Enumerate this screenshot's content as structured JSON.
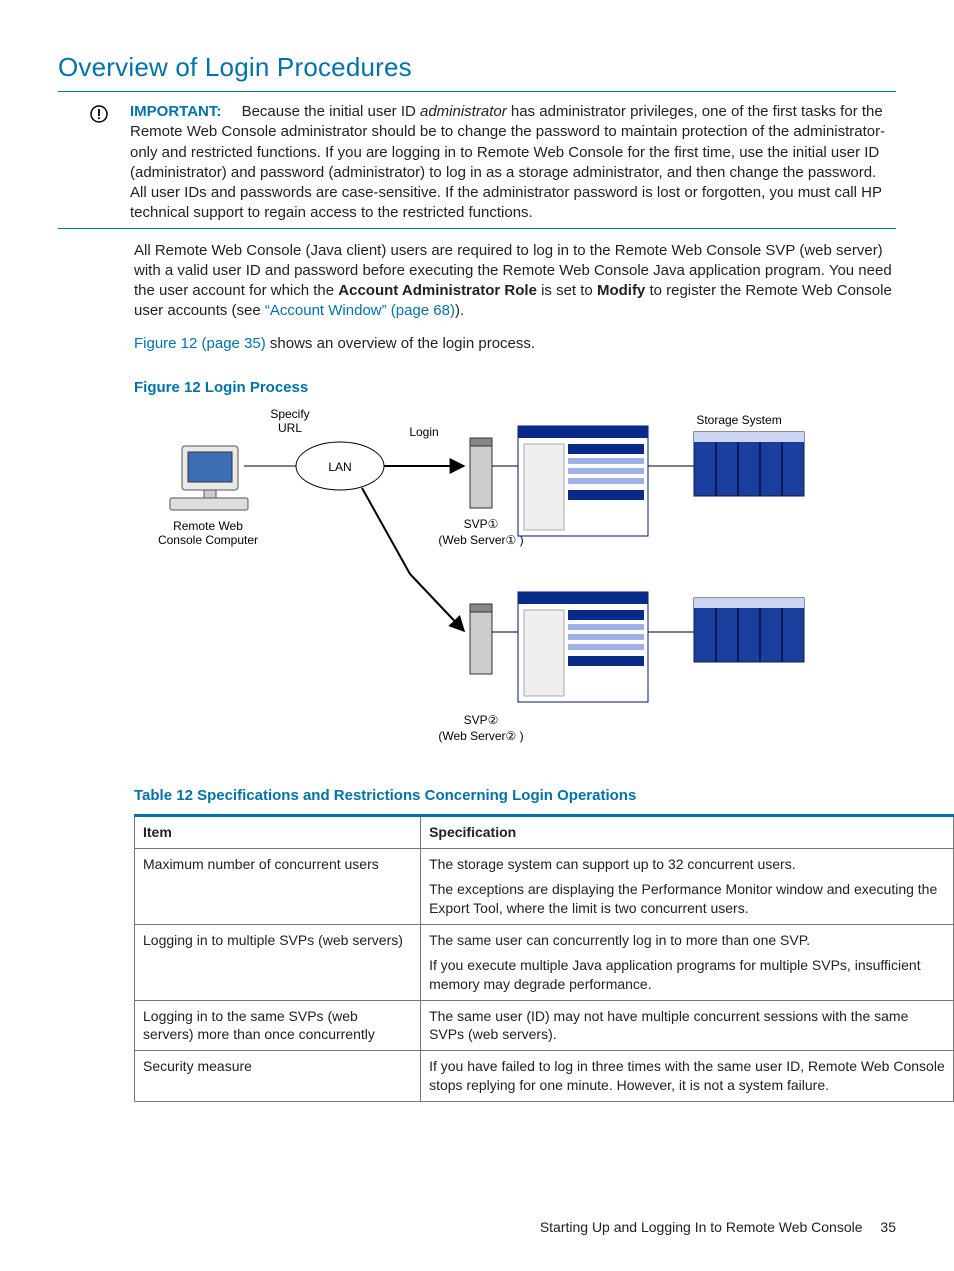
{
  "heading": "Overview of Login Procedures",
  "important": {
    "icon_name": "important-icon",
    "label": "IMPORTANT:",
    "leading": "Because the initial user ID ",
    "emph": "administrator",
    "rest": " has administrator privileges, one of the first tasks for the Remote Web Console administrator should be to change the password to maintain protection of the administrator-only and restricted functions. If you are logging in to Remote Web Console for the first time, use the initial user ID (administrator) and password (administrator) to log in as a storage administrator, and then change the password. All user IDs and passwords are case-sensitive. If the administrator password is lost or forgotten, you must call HP technical support to regain access to the restricted functions."
  },
  "p1": {
    "a": "All Remote Web Console (Java client) users are required to log in to the Remote Web Console SVP (web server) with a valid user ID and password before executing the Remote Web Console Java application program. You need the user account for which the ",
    "b_bold": "Account Administrator Role",
    "c": " is set to ",
    "d_bold": "Modify",
    "e": " to register the Remote Web Console user accounts (see ",
    "link": "“Account Window” (page 68)",
    "f": ")."
  },
  "p2": {
    "link": "Figure 12 (page 35)",
    "rest": " shows an overview of the login process."
  },
  "figure_caption": "Figure 12 Login Process",
  "diagram": {
    "specify_url": "Specify\nURL",
    "lan": "LAN",
    "login": "Login",
    "storage_system": "Storage System",
    "remote_web": "Remote Web\nConsole Computer",
    "svp1": "SVP①",
    "web_server1": "(Web Server① )",
    "svp2": "SVP②",
    "web_server2": "(Web Server② )"
  },
  "table_caption": "Table 12 Specifications and Restrictions Concerning Login Operations",
  "table": {
    "headers": {
      "col1": "Item",
      "col2": "Specification"
    },
    "rows": [
      {
        "item": "Maximum number of concurrent users",
        "spec": [
          "The storage system can support up to 32 concurrent users.",
          "The exceptions are displaying the Performance Monitor window and executing the Export Tool, where the limit is two concurrent users."
        ]
      },
      {
        "item": "Logging in to multiple SVPs (web servers)",
        "spec": [
          "The same user can concurrently log in to more than one SVP.",
          "If you execute multiple Java application programs for multiple SVPs, insufficient memory may degrade performance."
        ]
      },
      {
        "item": "Logging in to the same SVPs (web servers) more than once concurrently",
        "spec": [
          "The same user (ID) may not have multiple concurrent sessions with the same SVPs (web servers)."
        ]
      },
      {
        "item": "Security measure",
        "spec": [
          "If you have failed to log in three times with the same user ID, Remote Web Console stops replying for one minute. However, it is not a system failure."
        ]
      }
    ]
  },
  "footer": {
    "text": "Starting Up and Logging In to Remote Web Console",
    "page": "35"
  }
}
